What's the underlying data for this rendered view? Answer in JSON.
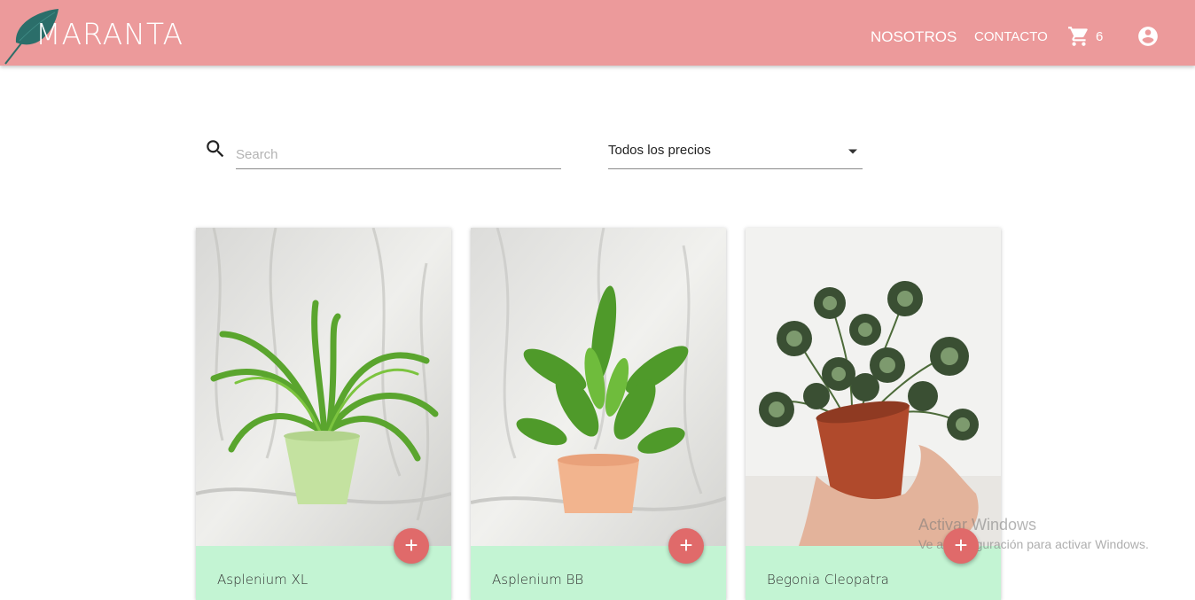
{
  "brand": {
    "name": "MARANTA",
    "primary": "#ec9a9b",
    "card_footer": "#c3f4d3",
    "fab": "#e06a6a"
  },
  "nav": {
    "links": [
      {
        "label": "NOSOTROS"
      },
      {
        "label": "CONTACTO"
      }
    ],
    "cart": {
      "icon": "cart-icon",
      "count": "6"
    },
    "account": {
      "icon": "account-circle-icon"
    }
  },
  "filters": {
    "search": {
      "placeholder": "Search",
      "value": "",
      "icon": "search-icon"
    },
    "price": {
      "selected": "Todos los precios",
      "icon": "caret-down-icon"
    }
  },
  "products": [
    {
      "name": "Asplenium XL",
      "add_icon": "plus-icon",
      "add": "+"
    },
    {
      "name": "Asplenium BB",
      "add_icon": "plus-icon",
      "add": "+"
    },
    {
      "name": "Begonia Cleopatra",
      "add_icon": "plus-icon",
      "add": "+"
    }
  ],
  "watermark": {
    "title": "Activar Windows",
    "subtitle": "Ve a Configuración para activar Windows."
  }
}
